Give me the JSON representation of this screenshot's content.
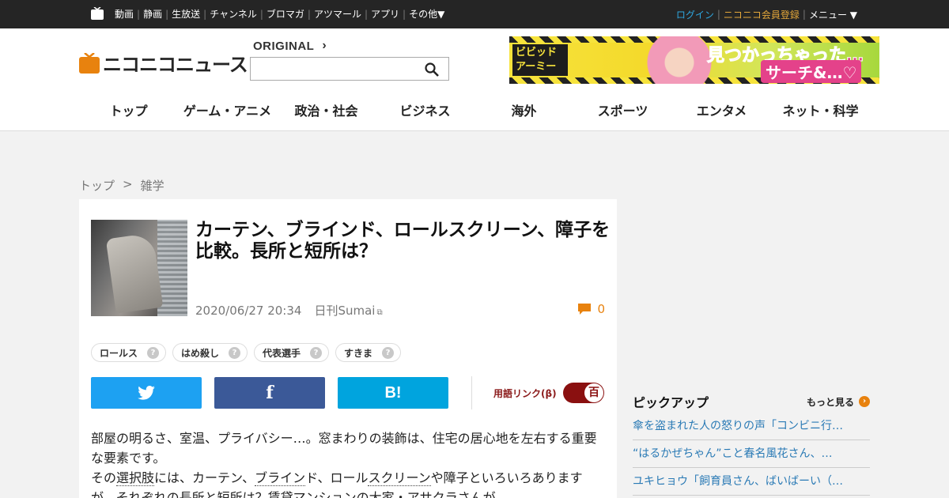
{
  "topbar": {
    "nav": [
      "動画",
      "静画",
      "生放送",
      "チャンネル",
      "ブロマガ",
      "アツマール",
      "アプリ",
      "その他▼"
    ],
    "login": "ログイン",
    "register": "ニコニコ会員登録",
    "menu": "メニュー ▼"
  },
  "header": {
    "logo_text": "ニコニコニュース",
    "original_label": "ORIGINAL",
    "search": {
      "value": "",
      "placeholder": ""
    },
    "banner": {
      "logo": "ビビッドアーミー",
      "copy_line1": "見つかっちゃった…",
      "copy_line2": "サーチ&…♡"
    },
    "categories": [
      "トップ",
      "ゲーム・アニメ",
      "政治・社会",
      "ビジネス",
      "海外",
      "スポーツ",
      "エンタメ",
      "ネット・科学"
    ]
  },
  "breadcrumb": {
    "home": "トップ",
    "separator": ">",
    "current": "雑学"
  },
  "article": {
    "title": "カーテン、ブラインド、ロールスクリーン、障子を比較。長所と短所は？",
    "date": "2020/06/27 20:34",
    "source": "日刊Sumai",
    "comment_count": "0",
    "tags": [
      "ロールス",
      "はめ殺し",
      "代表選手",
      "すきま"
    ],
    "share": {
      "hatena_label": "B!"
    },
    "term_link_label": "用語リンク(β)",
    "toggle_label": "百",
    "body": {
      "p1": "部屋の明るさ、室温、プライバシー…。窓まわりの装飾は、住宅の居心地を左右する重要な要素です。",
      "p2_a": "その",
      "p2_link1": "選択肢",
      "p2_b": "には、カーテン、",
      "p2_link2": "ブライン",
      "p2_c": "ド、ロール",
      "p2_link3": "スクリーン",
      "p2_d": "や障子といろいろありますが、それぞれの長所と短所は？賃貸マンションの大家・アサクラさんが"
    }
  },
  "pickup": {
    "title": "ピックアップ",
    "more_label": "もっと見る",
    "items": [
      "傘を盗まれた人の怒りの声「コンビニ行…",
      "“はるかぜちゃん”こと春名風花さん、…",
      "ユキヒョウ「飼育員さん、ばいばーい（…"
    ]
  },
  "colors": {
    "accent": "#e8820e",
    "link": "#2a7ab5",
    "twitter": "#1da1f2",
    "facebook": "#3b5998",
    "hatena": "#00a4de",
    "toggle": "#8a1010"
  }
}
